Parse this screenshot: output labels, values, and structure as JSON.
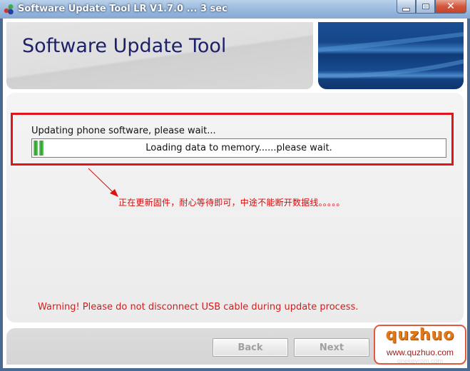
{
  "window": {
    "title": "Software Update Tool LR V1.7.0 ... 3 sec",
    "app_icon": "colored-molecule-icon",
    "controls": {
      "minimize": "minimize-icon",
      "maximize": "maximize-icon",
      "close": "✕"
    }
  },
  "header": {
    "title": "Software Update Tool",
    "banner": "blue-wave-banner"
  },
  "main": {
    "status_label": "Updating phone software, please wait...",
    "progress": {
      "text": "Loading data to memory......please wait.",
      "segments_filled": 2,
      "fill_color": "#22a022"
    },
    "annotation_cn": "正在更新固件，耐心等待即可，中途不能断开数据线。。。。。",
    "annotation_color": "#d40c0c",
    "warning": "Warning! Please do not disconnect USB cable during update process.",
    "warning_color": "#d41c1c",
    "highlight_color": "#e0141a"
  },
  "footer": {
    "back_label": "Back",
    "next_label": "Next"
  },
  "watermark": {
    "logo": "quzhuo",
    "url": "www.quzhuo.com",
    "sub": "onekeyrom.com"
  }
}
